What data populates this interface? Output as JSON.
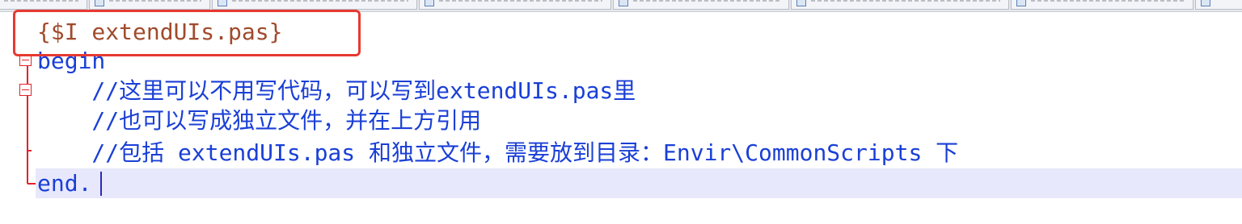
{
  "editor": {
    "code_lines": [
      "{$I extendUIs.pas}",
      "begin",
      "    //这里可以不用写代码，可以写到extendUIs.pas里",
      "    //也可以写成独立文件，并在上方引用",
      "    //包括 extendUIs.pas 和独立文件，需要放到目录：Envir\\CommonScripts 下",
      "end."
    ]
  },
  "colors": {
    "directive": "#a14a2c",
    "keyword": "#1a3fd6",
    "comment": "#1a3fd6",
    "fold_marker": "#e2222b",
    "annotation_box": "#e63a32",
    "current_line": "#e8e8fc"
  },
  "icons": {
    "fold_collapse": "fold-minus-icon",
    "file_tab": "file-tab-icon"
  }
}
